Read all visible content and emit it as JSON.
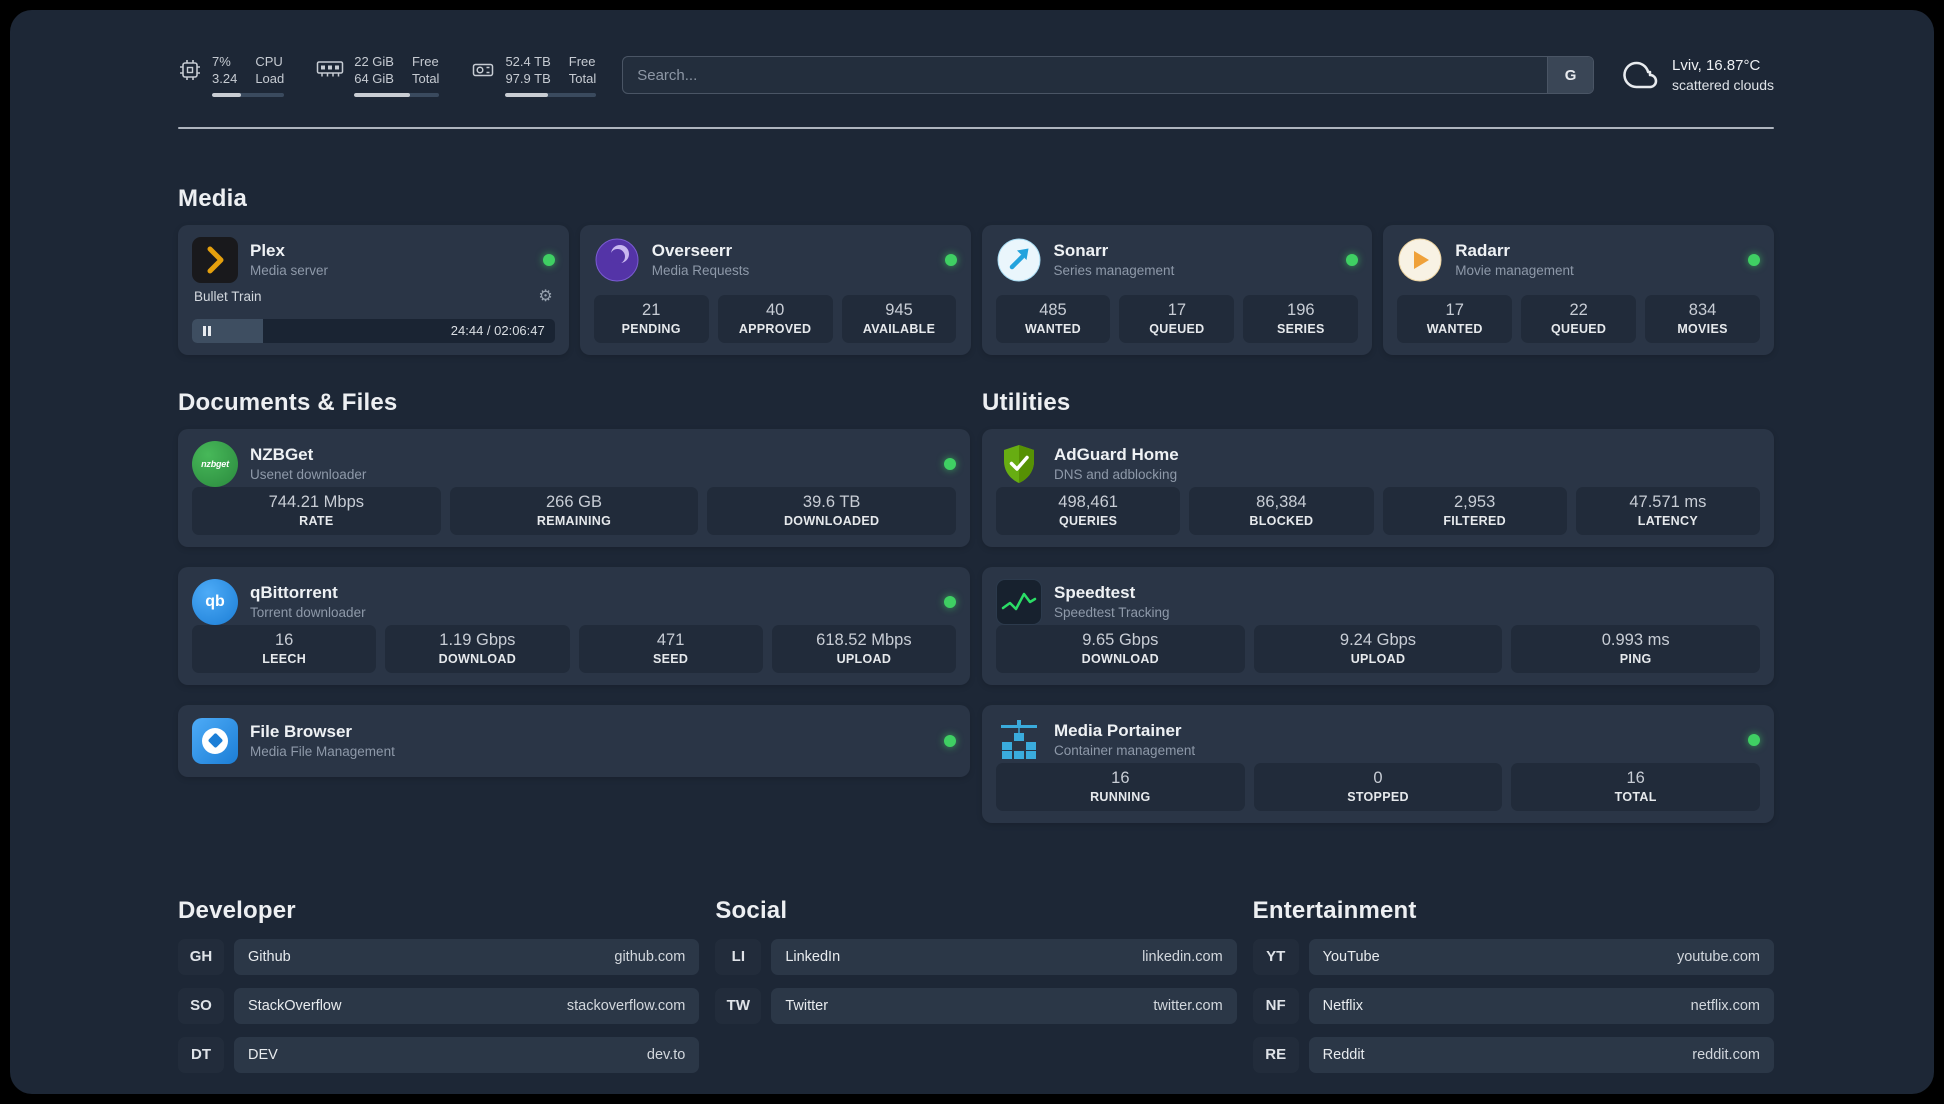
{
  "colors": {
    "background": "#1d2736",
    "card": "#2a3546",
    "tile": "#212b3a",
    "status_online": "#3fcf63",
    "plex_gold": "#e5a00d",
    "adguard_green": "#5f9f0a",
    "speedtest_green": "#2bdd66",
    "portainer_blue": "#3aabdc"
  },
  "topbar": {
    "monitors": [
      {
        "value_top": "7%",
        "value_bottom": "3.24",
        "label_top": "CPU",
        "label_bottom": "Load",
        "bar_percent": 40
      },
      {
        "value_top": "22 GiB",
        "value_bottom": "64 GiB",
        "label_top": "Free",
        "label_bottom": "Total",
        "bar_percent": 65
      },
      {
        "value_top": "52.4 TB",
        "value_bottom": "97.9 TB",
        "label_top": "Free",
        "label_bottom": "Total",
        "bar_percent": 47
      }
    ],
    "search": {
      "placeholder": "Search...",
      "button_label": "G"
    },
    "weather": {
      "location": "Lviv, 16.87°C",
      "condition": "scattered clouds"
    }
  },
  "media": {
    "title": "Media",
    "plex": {
      "name": "Plex",
      "subtitle": "Media server",
      "now_playing": "Bullet Train",
      "time": "24:44 / 02:06:47",
      "progress_percent": 19.5
    },
    "overseerr": {
      "name": "Overseerr",
      "subtitle": "Media Requests",
      "stats": [
        {
          "value": "21",
          "label": "PENDING"
        },
        {
          "value": "40",
          "label": "APPROVED"
        },
        {
          "value": "945",
          "label": "AVAILABLE"
        }
      ]
    },
    "sonarr": {
      "name": "Sonarr",
      "subtitle": "Series management",
      "stats": [
        {
          "value": "485",
          "label": "WANTED"
        },
        {
          "value": "17",
          "label": "QUEUED"
        },
        {
          "value": "196",
          "label": "SERIES"
        }
      ]
    },
    "radarr": {
      "name": "Radarr",
      "subtitle": "Movie management",
      "stats": [
        {
          "value": "17",
          "label": "WANTED"
        },
        {
          "value": "22",
          "label": "QUEUED"
        },
        {
          "value": "834",
          "label": "MOVIES"
        }
      ]
    }
  },
  "documents": {
    "title": "Documents & Files",
    "nzbget": {
      "name": "NZBGet",
      "subtitle": "Usenet downloader",
      "icon_text": "nzbget",
      "stats": [
        {
          "value": "744.21 Mbps",
          "label": "RATE"
        },
        {
          "value": "266 GB",
          "label": "REMAINING"
        },
        {
          "value": "39.6 TB",
          "label": "DOWNLOADED"
        }
      ]
    },
    "qbittorrent": {
      "name": "qBittorrent",
      "subtitle": "Torrent downloader",
      "icon_text": "qb",
      "stats": [
        {
          "value": "16",
          "label": "LEECH"
        },
        {
          "value": "1.19 Gbps",
          "label": "DOWNLOAD"
        },
        {
          "value": "471",
          "label": "SEED"
        },
        {
          "value": "618.52 Mbps",
          "label": "UPLOAD"
        }
      ]
    },
    "filebrowser": {
      "name": "File Browser",
      "subtitle": "Media File Management"
    }
  },
  "utilities": {
    "title": "Utilities",
    "adguard": {
      "name": "AdGuard Home",
      "subtitle": "DNS and adblocking",
      "stats": [
        {
          "value": "498,461",
          "label": "QUERIES"
        },
        {
          "value": "86,384",
          "label": "BLOCKED"
        },
        {
          "value": "2,953",
          "label": "FILTERED"
        },
        {
          "value": "47.571 ms",
          "label": "LATENCY"
        }
      ]
    },
    "speedtest": {
      "name": "Speedtest",
      "subtitle": "Speedtest Tracking",
      "stats": [
        {
          "value": "9.65 Gbps",
          "label": "DOWNLOAD"
        },
        {
          "value": "9.24 Gbps",
          "label": "UPLOAD"
        },
        {
          "value": "0.993 ms",
          "label": "PING"
        }
      ]
    },
    "portainer": {
      "name": "Media Portainer",
      "subtitle": "Container management",
      "stats": [
        {
          "value": "16",
          "label": "RUNNING"
        },
        {
          "value": "0",
          "label": "STOPPED"
        },
        {
          "value": "16",
          "label": "TOTAL"
        }
      ]
    }
  },
  "links": {
    "developer": {
      "title": "Developer",
      "items": [
        {
          "badge": "GH",
          "name": "Github",
          "url": "github.com"
        },
        {
          "badge": "SO",
          "name": "StackOverflow",
          "url": "stackoverflow.com"
        },
        {
          "badge": "DT",
          "name": "DEV",
          "url": "dev.to"
        }
      ]
    },
    "social": {
      "title": "Social",
      "items": [
        {
          "badge": "LI",
          "name": "LinkedIn",
          "url": "linkedin.com"
        },
        {
          "badge": "TW",
          "name": "Twitter",
          "url": "twitter.com"
        }
      ]
    },
    "entertainment": {
      "title": "Entertainment",
      "items": [
        {
          "badge": "YT",
          "name": "YouTube",
          "url": "youtube.com"
        },
        {
          "badge": "NF",
          "name": "Netflix",
          "url": "netflix.com"
        },
        {
          "badge": "RE",
          "name": "Reddit",
          "url": "reddit.com"
        }
      ]
    }
  }
}
